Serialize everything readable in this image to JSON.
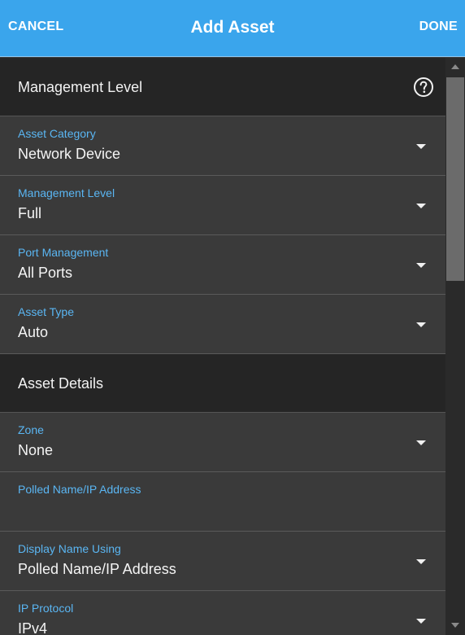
{
  "header": {
    "cancel_label": "CANCEL",
    "title": "Add Asset",
    "done_label": "DONE"
  },
  "sections": {
    "management": {
      "title": "Management Level",
      "help_icon": "help-circle-icon"
    },
    "details": {
      "title": "Asset Details"
    }
  },
  "fields": {
    "asset_category": {
      "label": "Asset Category",
      "value": "Network Device"
    },
    "management_level": {
      "label": "Management Level",
      "value": "Full"
    },
    "port_management": {
      "label": "Port Management",
      "value": "All Ports"
    },
    "asset_type": {
      "label": "Asset Type",
      "value": "Auto"
    },
    "zone": {
      "label": "Zone",
      "value": "None"
    },
    "polled_name": {
      "label": "Polled Name/IP Address",
      "value": ""
    },
    "display_name_using": {
      "label": "Display Name Using",
      "value": "Polled Name/IP Address"
    },
    "ip_protocol": {
      "label": "IP Protocol",
      "value": "IPv4"
    }
  },
  "colors": {
    "header_bg": "#3aa5ec",
    "field_label": "#5ab6f3",
    "section_bg": "#252525",
    "field_bg": "#3a3a3a"
  }
}
